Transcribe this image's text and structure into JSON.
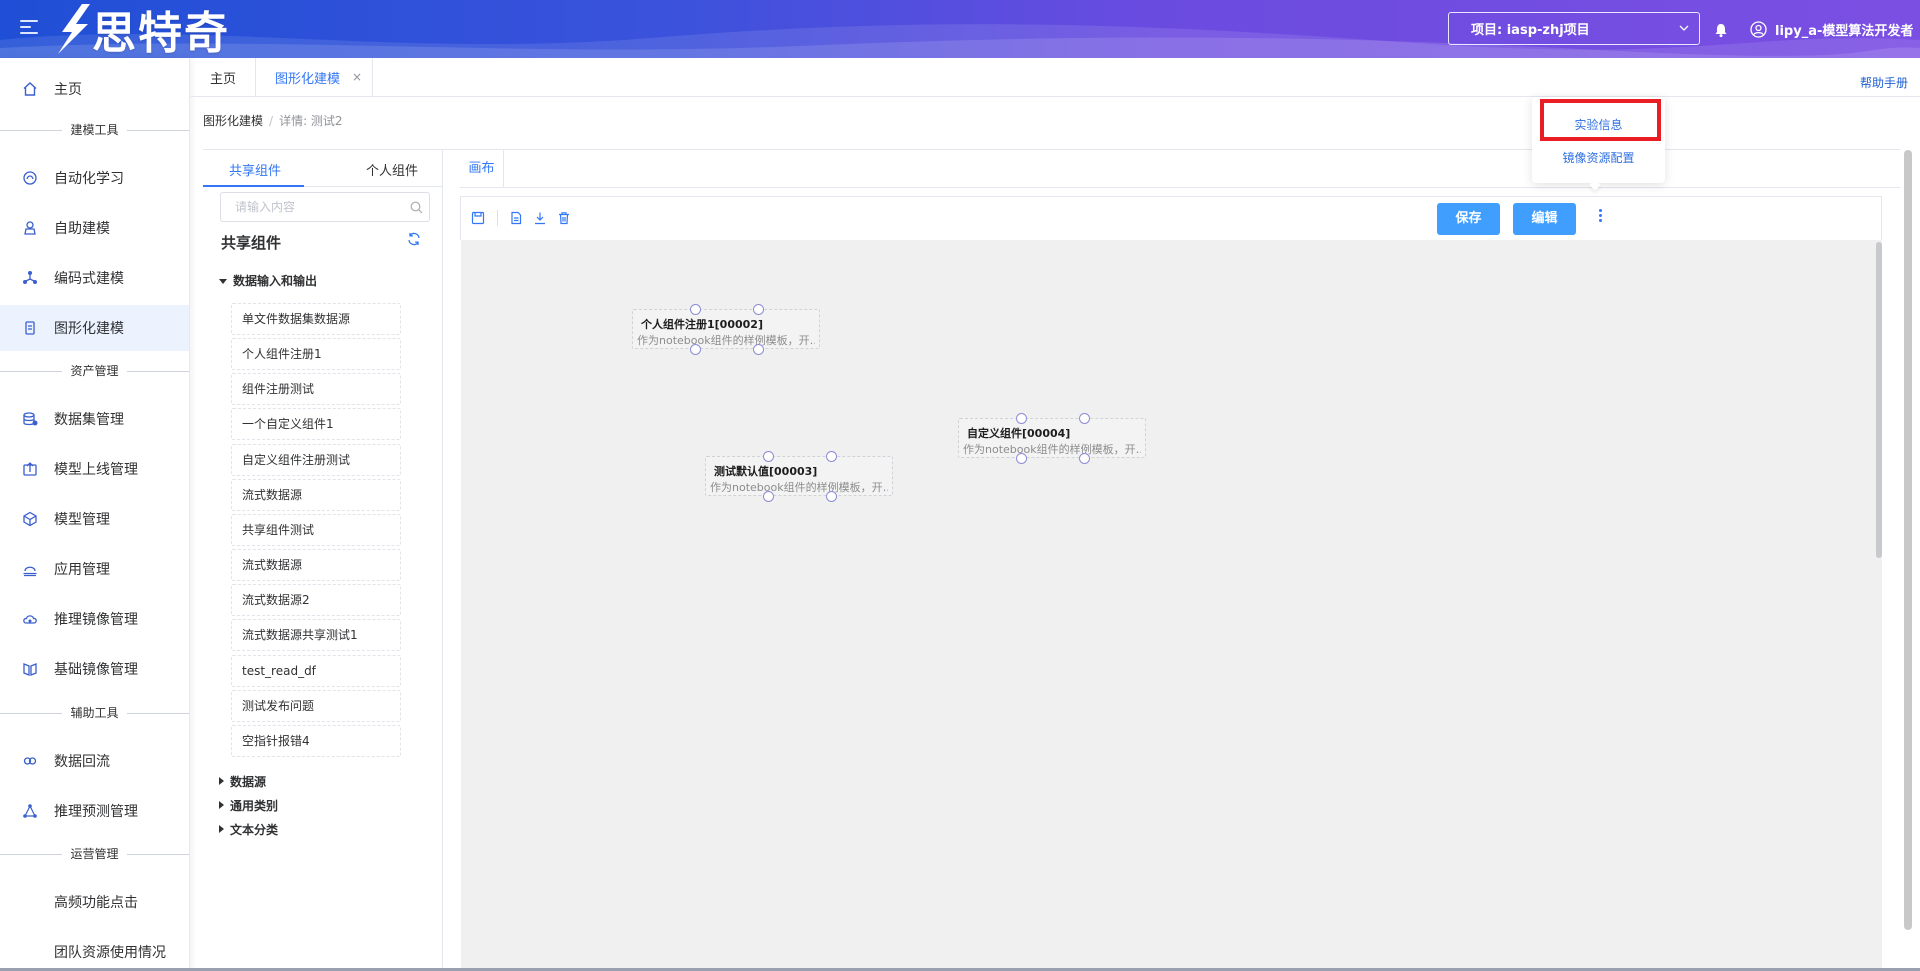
{
  "app": {
    "logo_text": "思特奇",
    "project_select": "项目: iasp-zhj项目",
    "user_name": "lipy_a-模型算法开发者"
  },
  "colors": {
    "accent": "#3377f5",
    "button": "#409eff",
    "highlight": "#ea1c24",
    "header_start": "#1f4fd6",
    "header_end": "#7b4fe2"
  },
  "sidebar": {
    "home": "主页",
    "groups": {
      "build_tools": "建模工具",
      "asset_mgmt": "资产管理",
      "aux_tools": "辅助工具",
      "ops_mgmt": "运营管理"
    },
    "items": [
      {
        "label": "自动化学习",
        "icon": "automl-icon"
      },
      {
        "label": "自助建模",
        "icon": "self-model-icon"
      },
      {
        "label": "编码式建模",
        "icon": "code-model-icon"
      },
      {
        "label": "图形化建模",
        "icon": "graph-model-icon",
        "active": true
      },
      {
        "label": "数据集管理",
        "icon": "dataset-icon"
      },
      {
        "label": "模型上线管理",
        "icon": "deploy-icon"
      },
      {
        "label": "模型管理",
        "icon": "model-icon"
      },
      {
        "label": "应用管理",
        "icon": "app-icon"
      },
      {
        "label": "推理镜像管理",
        "icon": "infer-image-icon"
      },
      {
        "label": "基础镜像管理",
        "icon": "base-image-icon"
      },
      {
        "label": "数据回流",
        "icon": "data-reflow-icon"
      },
      {
        "label": "推理预测管理",
        "icon": "predict-icon"
      },
      {
        "label": "高频功能点击",
        "icon": ""
      },
      {
        "label": "团队资源使用情况",
        "icon": ""
      }
    ]
  },
  "tabs": {
    "home": "主页",
    "graph": "图形化建模",
    "close": "×",
    "help": "帮助手册"
  },
  "breadcrumb": {
    "root": "图形化建模",
    "sep": "/",
    "current": "详情: 测试2"
  },
  "components": {
    "tab_shared": "共享组件",
    "tab_personal": "个人组件",
    "search_placeholder": "请输入内容",
    "title": "共享组件",
    "category_open": "数据输入和输出",
    "items": [
      "单文件数据集数据源",
      "个人组件注册1",
      "组件注册测试",
      "一个自定义组件1",
      "自定义组件注册测试",
      "流式数据源",
      "共享组件测试",
      "流式数据源",
      "流式数据源2",
      "流式数据源共享测试1",
      "test_read_df",
      "测试发布问题",
      "空指针报错4"
    ],
    "categories_closed": [
      "数据源",
      "通用类别",
      "文本分类"
    ]
  },
  "canvas": {
    "tab": "画布",
    "save": "保存",
    "edit": "编辑",
    "nodes": [
      {
        "title": "个人组件注册1[00002]",
        "desc": "作为notebook组件的样例模板，开…"
      },
      {
        "title": "测试默认值[00003]",
        "desc": "作为notebook组件的样例模板，开…"
      },
      {
        "title": "自定义组件[00004]",
        "desc": "作为notebook组件的样例模板，开…"
      }
    ]
  },
  "popover": {
    "item1": "实验信息",
    "item2": "镜像资源配置"
  }
}
